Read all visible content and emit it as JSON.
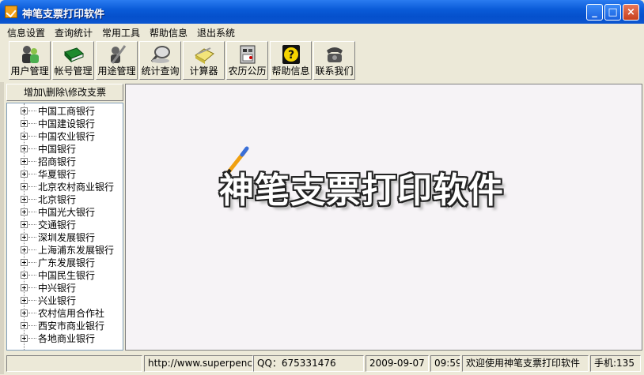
{
  "window": {
    "title": "神笔支票打印软件",
    "min_label": "_",
    "max_label": "□",
    "close_label": "×"
  },
  "menu": [
    "信息设置",
    "查询统计",
    "常用工具",
    "帮助信息",
    "退出系统"
  ],
  "toolbar": [
    {
      "label": "用户管理",
      "icon": "users-icon"
    },
    {
      "label": "帐号管理",
      "icon": "book-icon"
    },
    {
      "label": "用途管理",
      "icon": "pen-person-icon"
    },
    {
      "label": "统计查询",
      "icon": "magnifier-icon"
    },
    {
      "label": "计算器",
      "icon": "calculator-icon"
    },
    {
      "label": "农历公历",
      "icon": "calendar-icon"
    },
    {
      "label": "帮助信息",
      "icon": "help-icon"
    },
    {
      "label": "联系我们",
      "icon": "telephone-icon"
    }
  ],
  "left_panel": {
    "header": "增加\\删除\\修改支票",
    "banks": [
      "中国工商银行",
      "中国建设银行",
      "中国农业银行",
      "中国银行",
      "招商银行",
      "华夏银行",
      "北京农村商业银行",
      "北京银行",
      "中国光大银行",
      "交通银行",
      "深圳发展银行",
      "上海浦东发展银行",
      "广东发展银行",
      "中国民生银行",
      "中兴银行",
      "兴业银行",
      "农村信用合作社",
      "西安市商业银行",
      "各地商业银行"
    ]
  },
  "main": {
    "logo_text": "神笔支票打印软件"
  },
  "statusbar": {
    "website": "http://www.superpencil.net",
    "qq": "QQ：675331476",
    "date": "2009-09-07",
    "time": "09:59",
    "welcome": "欢迎使用神笔支票打印软件",
    "phone": "手机:135"
  },
  "colors": {
    "title_bar": "#0A5BD8",
    "main_bg": "#F6F3F6",
    "chrome": "#ECE9D8"
  }
}
